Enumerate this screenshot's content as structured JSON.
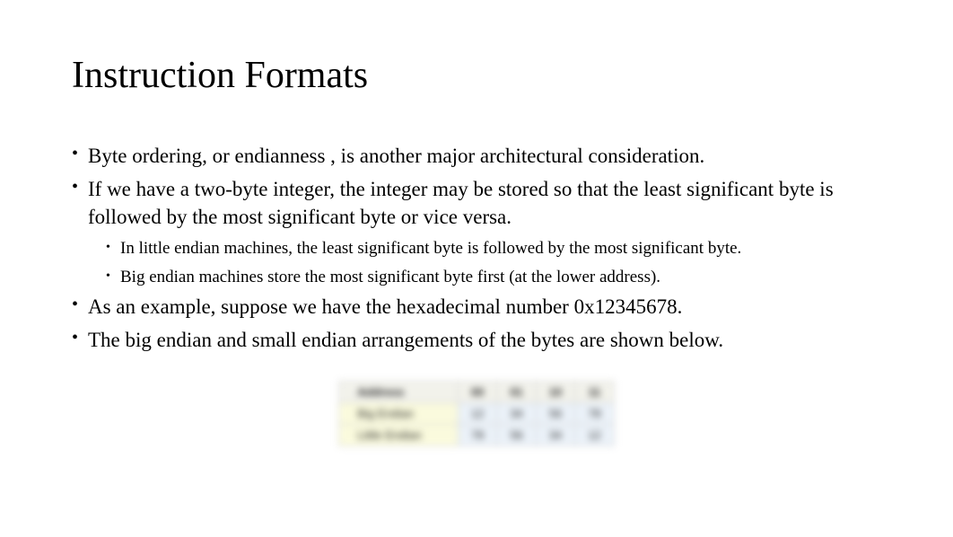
{
  "title": "Instruction Formats",
  "bullets": {
    "b1": "Byte ordering, or endianness , is another major architectural consideration.",
    "b2": "If we have a two-byte integer, the integer may be stored so that the least significant byte is followed by the most significant byte or vice versa.",
    "b2a": "In little endian machines, the least significant byte is followed by the most significant byte.",
    "b2b": "Big endian machines store the most significant byte first (at the lower address).",
    "b3": "As an example, suppose we have the hexadecimal number 0x12345678.",
    "b4": "The big endian and small endian arrangements of the bytes are shown below."
  },
  "table": {
    "header_label": "Address",
    "addresses": [
      "00",
      "01",
      "10",
      "11"
    ],
    "rows": [
      {
        "label": "Big Endian",
        "cells": [
          "12",
          "34",
          "56",
          "78"
        ]
      },
      {
        "label": "Little Endian",
        "cells": [
          "78",
          "56",
          "34",
          "12"
        ]
      }
    ]
  }
}
